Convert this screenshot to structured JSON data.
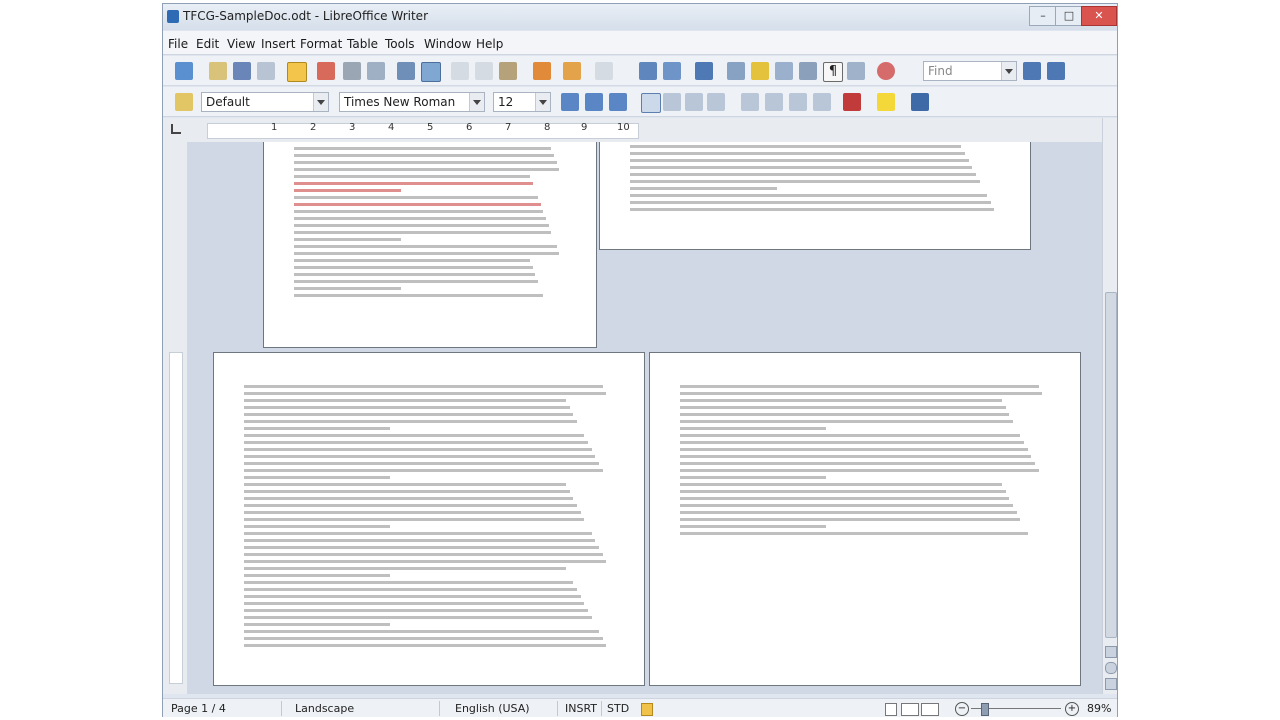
{
  "window": {
    "title": "TFCG-SampleDoc.odt - LibreOffice Writer",
    "min_label": "–",
    "max_label": "□",
    "close_label": "✕"
  },
  "menu": [
    "File",
    "Edit",
    "View",
    "Insert",
    "Format",
    "Table",
    "Tools",
    "Window",
    "Help"
  ],
  "formatting": {
    "style": "Default",
    "font": "Times New Roman",
    "size": "12"
  },
  "find": {
    "placeholder": "Find"
  },
  "ruler": {
    "numbers": [
      "1",
      "2",
      "3",
      "4",
      "5",
      "6",
      "7",
      "8",
      "9",
      "10"
    ]
  },
  "statusbar": {
    "page": "Page 1 / 4",
    "orientation": "Landscape",
    "language": "English (USA)",
    "insert_mode": "INSRT",
    "selection_mode": "STD",
    "zoom": "89%"
  },
  "colors": {
    "accent": "#2f6bb5",
    "workspace": "#cfd8e4"
  }
}
